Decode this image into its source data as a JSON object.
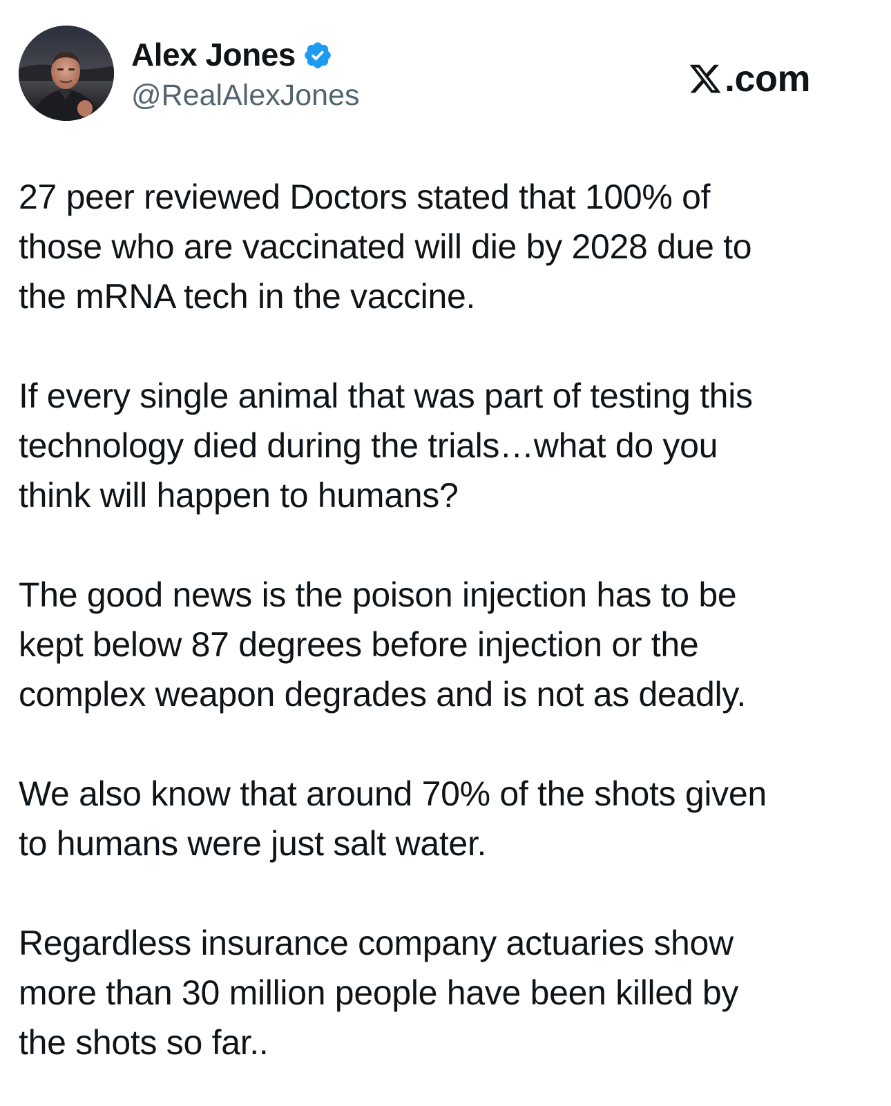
{
  "post": {
    "author": {
      "display_name": "Alex Jones",
      "handle": "@RealAlexJones",
      "verified": true,
      "avatar_icon": "avatar-photo"
    },
    "brand": {
      "logo_icon": "x-logo-icon",
      "text": ".com"
    },
    "paragraphs": [
      "27 peer reviewed Doctors stated that 100% of\nthose who are vaccinated will die by 2028 due to\nthe mRNA tech in the vaccine.",
      "If every single animal that was part of testing this\ntechnology died during the trials…what do you\nthink will happen to humans?",
      "The good news is the poison injection has to be\nkept below 87 degrees before injection or the\ncomplex weapon degrades and is not as deadly.",
      "We also know that around 70% of the shots given\nto humans were just salt water.",
      "Regardless insurance company actuaries show\nmore than 30 million people have  been killed by\nthe shots so far.."
    ]
  },
  "colors": {
    "text_primary": "#0f1419",
    "text_secondary": "#536471",
    "verified_blue": "#1d9bf0",
    "background": "#ffffff"
  }
}
